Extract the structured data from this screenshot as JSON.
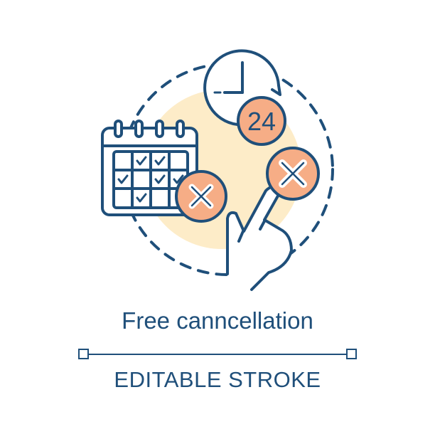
{
  "illustration": {
    "clock_badge_text": "24",
    "colors": {
      "stroke": "#1f4f7a",
      "accent": "#f6ad86",
      "backdrop": "#fdecc8",
      "background": "#ffffff"
    },
    "icons": [
      "calendar-icon",
      "clock-icon",
      "cancel-x-icon",
      "pointing-hand-icon"
    ]
  },
  "title": "Free canncellation",
  "subtitle": "EDITABLE STROKE"
}
